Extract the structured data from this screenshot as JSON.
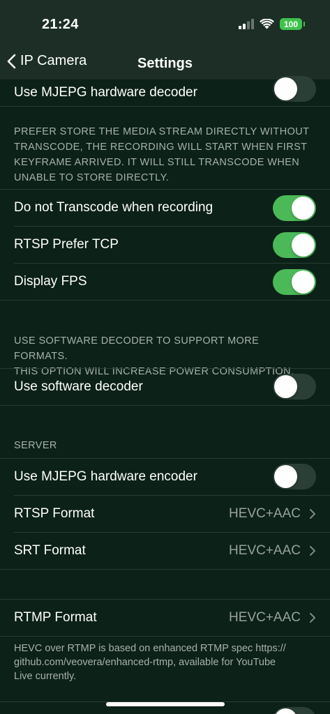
{
  "status": {
    "time": "21:24",
    "battery": "100"
  },
  "nav": {
    "back_label": "IP Camera",
    "title": "Settings"
  },
  "rows": {
    "mjepg_decoder": "Use MJEPG hardware decoder",
    "no_transcode": "Do not Transcode when recording",
    "rtsp_tcp": "RTSP Prefer TCP",
    "display_fps": "Display FPS",
    "software_decoder": "Use software decoder",
    "mjepg_encoder": "Use MJEPG hardware encoder",
    "rtsp_format": "RTSP Format",
    "srt_format": "SRT Format",
    "rtmp_format": "RTMP Format"
  },
  "values": {
    "rtsp_format": "HEVC+AAC",
    "srt_format": "HEVC+AAC",
    "rtmp_format": "HEVC+AAC"
  },
  "toggles": {
    "mjepg_decoder": false,
    "no_transcode": true,
    "rtsp_tcp": true,
    "display_fps": true,
    "software_decoder": false,
    "mjepg_encoder": false
  },
  "footers": {
    "transcode_line1": "PREFER STORE THE MEDIA STREAM DIRECTLY WITHOUT",
    "transcode_line2": "TRANSCODE, THE RECORDING WILL START WHEN FIRST",
    "transcode_line3": "KEYFRAME ARRIVED. IT WILL STILL TRANSCODE WHEN",
    "transcode_line4": "UNABLE TO STORE DIRECTLY.",
    "software_line1": "USE SOFTWARE DECODER TO SUPPORT MORE FORMATS.",
    "software_line2": "THIS OPTION WILL INCREASE POWER CONSUMPTION.",
    "server_header": "SERVER",
    "rtmp_line1": "HEVC over RTMP is based on enhanced RTMP spec https://",
    "rtmp_line2": "github.com/veovera/enhanced-rtmp, available for YouTube",
    "rtmp_line3": "Live currently."
  },
  "colors": {
    "background": "#0c2118",
    "toggle_on": "#4cb959",
    "toggle_off": "#2b3f36",
    "secondary_text": "#a7b1ac"
  }
}
